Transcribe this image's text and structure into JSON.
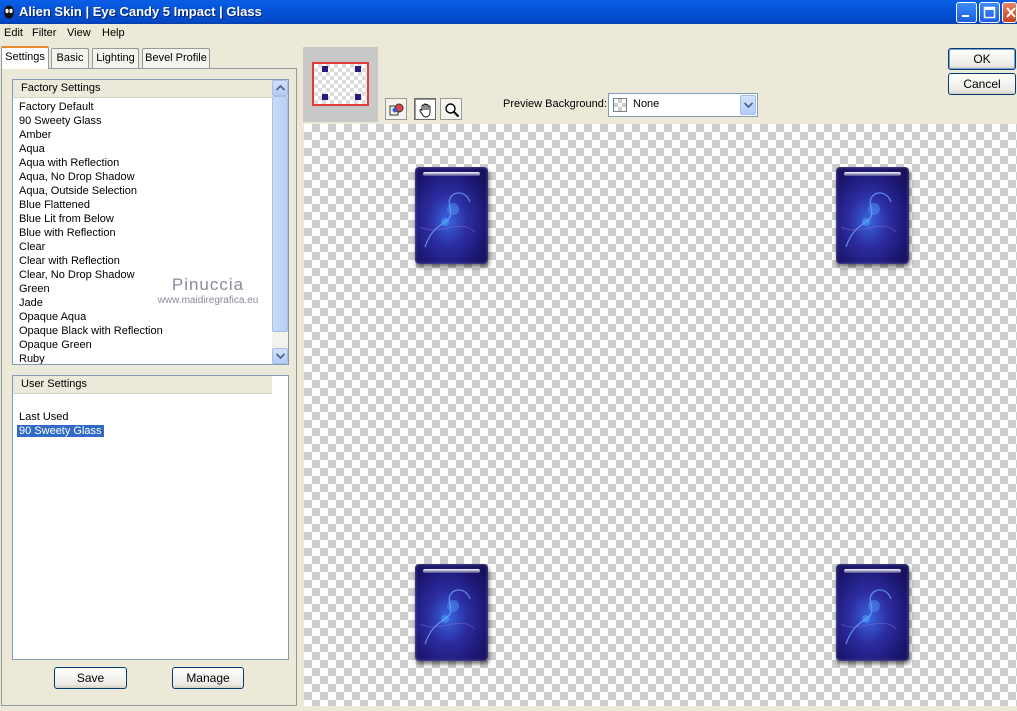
{
  "window": {
    "title": "Alien Skin  |  Eye Candy 5 Impact  |  Glass"
  },
  "menu": [
    "Edit",
    "Filter",
    "View",
    "Help"
  ],
  "tabs": [
    "Settings",
    "Basic",
    "Lighting",
    "Bevel Profile"
  ],
  "factory_settings": {
    "header": "Factory Settings",
    "items": [
      "Factory Default",
      "90 Sweety Glass",
      "Amber",
      "Aqua",
      "Aqua with Reflection",
      "Aqua, No Drop Shadow",
      "Aqua, Outside Selection",
      "Blue Flattened",
      "Blue Lit from Below",
      "Blue with Reflection",
      "Clear",
      "Clear with Reflection",
      "Clear, No Drop Shadow",
      "Green",
      "Jade",
      "Opaque Aqua",
      "Opaque Black with Reflection",
      "Opaque Green",
      "Ruby"
    ]
  },
  "watermark": {
    "line1": "Pinuccia",
    "line2": "www.maidiregrafica.eu"
  },
  "user_settings": {
    "header": "User Settings",
    "items": [
      "Last Used",
      "90 Sweety Glass"
    ],
    "selected": "90 Sweety Glass"
  },
  "buttons": {
    "save": "Save",
    "manage": "Manage",
    "ok": "OK",
    "cancel": "Cancel"
  },
  "preview_background": {
    "label": "Preview Background:",
    "value": "None"
  },
  "tools": [
    "compare-icon",
    "hand-icon",
    "zoom-icon"
  ],
  "colors": {
    "selection": "#316AC5",
    "tile": "#1C1670",
    "title_bar": "#0453D8"
  }
}
